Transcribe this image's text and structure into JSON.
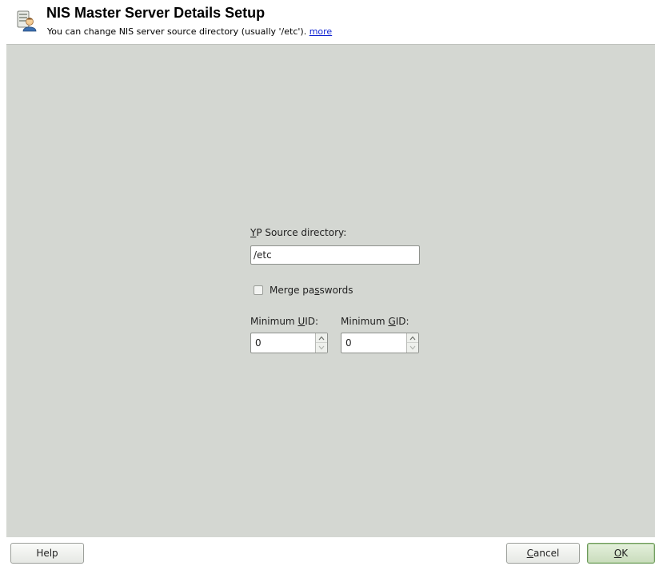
{
  "header": {
    "title": "NIS Master Server Details Setup",
    "subtitle": "You can change NIS server source directory (usually '/etc'). ",
    "more_link": "more",
    "icon": "server-setup-icon"
  },
  "form": {
    "yp_source_label_accel": "Y",
    "yp_source_label_rest": "P Source directory:",
    "yp_source_value": "/etc",
    "merge_passwords_label_pre": "Merge pa",
    "merge_passwords_label_accel": "s",
    "merge_passwords_label_post": "swords",
    "merge_passwords_checked": false,
    "min_uid_label_pre": "Minimum ",
    "min_uid_label_accel": "U",
    "min_uid_label_post": "ID:",
    "min_uid_value": "0",
    "min_gid_label_pre": "Minimum ",
    "min_gid_label_accel": "G",
    "min_gid_label_post": "ID:",
    "min_gid_value": "0"
  },
  "buttons": {
    "help": "Help",
    "cancel_accel": "C",
    "cancel_rest": "ancel",
    "ok_accel": "O",
    "ok_rest": "K"
  },
  "colors": {
    "panel_bg": "#d4d7d2",
    "link": "#0b1fd0",
    "ok_accent": "#6d9a5b"
  }
}
